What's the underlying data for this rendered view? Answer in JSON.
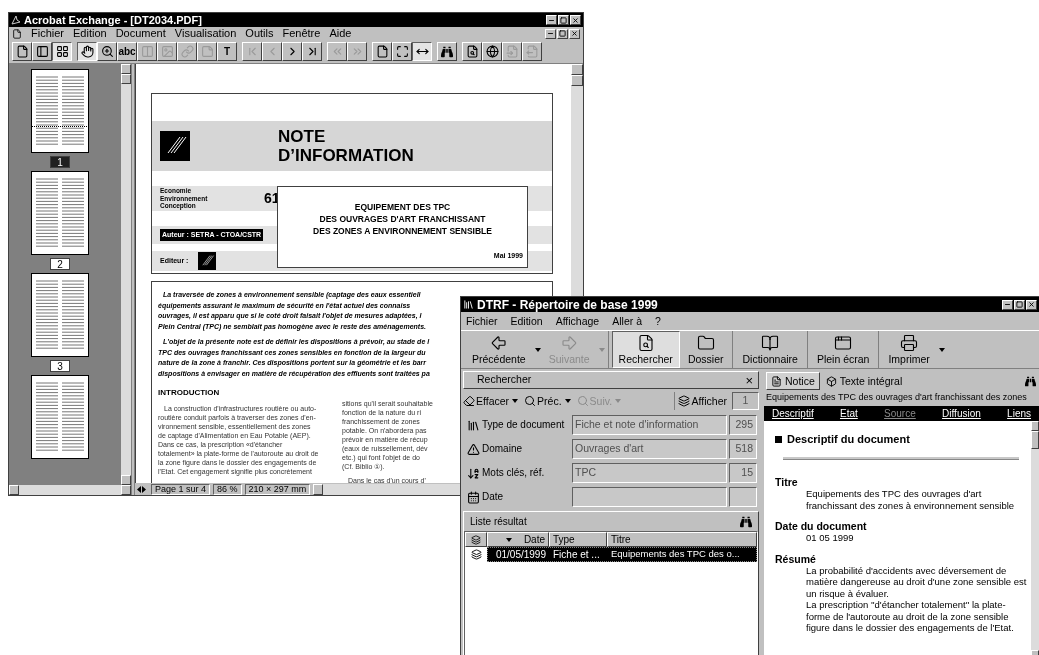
{
  "acrobat": {
    "title": "Acrobat Exchange - [DT2034.PDF]",
    "menu": [
      "Fichier",
      "Edition",
      "Document",
      "Visualisation",
      "Outils",
      "Fenêtre",
      "Aide"
    ],
    "toolbar": [
      [
        {
          "pressed": false,
          "disabled": false
        },
        {
          "pressed": false,
          "disabled": false
        },
        {
          "pressed": true,
          "disabled": false
        }
      ],
      [
        {
          "pressed": true,
          "disabled": false
        },
        {
          "pressed": false,
          "disabled": false
        },
        {
          "pressed": false,
          "disabled": false,
          "label": "abc"
        },
        {
          "pressed": false,
          "disabled": true
        },
        {
          "pressed": false,
          "disabled": true
        },
        {
          "pressed": false,
          "disabled": true
        },
        {
          "pressed": false,
          "disabled": true
        },
        {
          "pressed": false,
          "disabled": false,
          "label": "T"
        }
      ],
      [
        {
          "pressed": false,
          "disabled": true
        },
        {
          "pressed": false,
          "disabled": true
        },
        {
          "pressed": false,
          "disabled": false
        },
        {
          "pressed": false,
          "disabled": false
        }
      ],
      [
        {
          "pressed": false,
          "disabled": true
        },
        {
          "pressed": false,
          "disabled": true
        }
      ],
      [
        {
          "pressed": false,
          "disabled": false
        },
        {
          "pressed": false,
          "disabled": false
        },
        {
          "pressed": true,
          "disabled": false
        }
      ],
      [
        {
          "pressed": false,
          "disabled": false
        }
      ],
      [
        {
          "pressed": false,
          "disabled": false
        },
        {
          "pressed": false,
          "disabled": false
        },
        {
          "pressed": false,
          "disabled": true
        },
        {
          "pressed": false,
          "disabled": true
        }
      ]
    ],
    "thumbnails": [
      {
        "label": "1",
        "selected": true
      },
      {
        "label": "2",
        "selected": false
      },
      {
        "label": "3",
        "selected": false
      },
      {
        "selected": false
      }
    ],
    "document": {
      "title_lines": [
        "NOTE",
        "D’INFORMATION"
      ],
      "categories": [
        "Economie",
        "Environnement",
        "Conception"
      ],
      "number": "61",
      "author": "Auteur : SETRA - CTOA/CSTR",
      "editor": "Editeur :",
      "box_title_lines": [
        "EQUIPEMENT DES TPC",
        "DES OUVRAGES D'ART FRANCHISSANT",
        "DES ZONES A ENVIRONNEMENT SENSIBLE"
      ],
      "box_date": "Mai 1999",
      "abstract": [
        [
          "La traversée de zones à environnement sensible (captage des eaux essentiell",
          "équipements assurant le maximum de sécurité en l'état actuel des connaiss",
          "ouvrages, il est apparu que si le coté droit faisait l'objet de mesures adaptées, l",
          "Plein Central (TPC) ne semblait pas homogène avec le reste des aménagements."
        ],
        [
          "L'objet de la présente note est de définir les dispositions à prévoir, au stade de l",
          "TPC des ouvrages franchissant ces zones sensibles en fonction de la largeur du",
          "nature de la zone à franchir. Ces dispositions portent sur la géométrie et les barr",
          "dispositions à envisager en matière de récupération des effluents sont traitées pa"
        ]
      ],
      "heading": "INTRODUCTION",
      "left_column": [
        "La construction d'infrastructures routière ou auto-",
        "routière conduit parfois à traverser des zones d'en-",
        "vironnement sensible, essentiellement des zones",
        "de captage d'Alimentation en Eau Potable (AEP).",
        "Dans ce cas, la prescription «d'étancher",
        "totalement» la plate-forme de l'autoroute au droit de",
        "la zone figure dans le dossier des engagements de",
        "l'Etat. Cet engagement signifie plus concrètement"
      ],
      "right_column": [
        [
          "sitions qu'il serait souhaitable",
          "fonction de la nature du ri",
          "franchissement de zones",
          "potable. On n'abordera pas",
          "prévoir en matière de récup",
          "(eaux de ruissellement, dév",
          "etc.) qui font l'objet de do",
          "(Cf. Biblio ①)."
        ],
        [
          "Dans le cas d'un cours d'"
        ]
      ]
    },
    "status": {
      "page": "Page 1 sur 4",
      "zoom": "86 %",
      "size": "210 × 297 mm"
    }
  },
  "dtrf": {
    "title": "DTRF - Répertoire de base 1999",
    "menu": [
      "Fichier",
      "Edition",
      "Affichage",
      "Aller à",
      "?"
    ],
    "toolbar": [
      [
        {
          "label": "Précédente",
          "disabled": false,
          "pressed": false,
          "dropdown": true
        },
        {
          "label": "Suivante",
          "disabled": true,
          "pressed": false,
          "dropdown": true
        }
      ],
      [
        {
          "label": "Rechercher",
          "disabled": false,
          "pressed": true,
          "dropdown": false
        },
        {
          "label": "Dossier",
          "disabled": false,
          "pressed": false,
          "dropdown": false
        }
      ],
      [
        {
          "label": "Dictionnaire",
          "disabled": false,
          "pressed": false,
          "dropdown": false
        }
      ],
      [
        {
          "label": "Plein écran",
          "disabled": false,
          "pressed": false,
          "dropdown": false
        }
      ],
      [
        {
          "label": "Imprimer",
          "disabled": false,
          "pressed": false,
          "dropdown": true
        }
      ]
    ],
    "search": {
      "title": "Rechercher",
      "close": "×",
      "actions": [
        {
          "label": "Effacer",
          "disabled": false,
          "dropdown": true
        },
        {
          "label": "Préc.",
          "disabled": false,
          "dropdown": true
        },
        {
          "label": "Suiv.",
          "disabled": true,
          "dropdown": true
        }
      ],
      "show": "Afficher",
      "count": "1",
      "fields": [
        {
          "label": "Type de document",
          "value": "Fiche et note d'information",
          "count": "295"
        },
        {
          "label": "Domaine",
          "value": "Ouvrages d'art",
          "count": "518"
        },
        {
          "label": "Mots clés, réf.",
          "value": "TPC",
          "count": "15"
        },
        {
          "label": "Date"
        }
      ]
    },
    "results": {
      "title": "Liste résultat",
      "columns": [
        "Date",
        "Type",
        "Titre"
      ],
      "rows": [
        {
          "date": "01/05/1999",
          "type": "Fiche et ...",
          "title": "Equipements des TPC des o...",
          "selected": true
        }
      ]
    },
    "notice": {
      "tabs": [
        {
          "label": "Notice",
          "selected": true
        },
        {
          "label": "Texte intégral",
          "selected": false
        }
      ],
      "doc_title": "Equipements des TPC des ouvrages d'art franchissant des zones",
      "links": [
        {
          "label": "Descriptif",
          "disabled": false
        },
        {
          "label": "Etat",
          "disabled": false
        },
        {
          "label": "Source",
          "disabled": true
        },
        {
          "label": "Diffusion",
          "disabled": false
        },
        {
          "label": "Liens",
          "disabled": false
        }
      ],
      "section": "Descriptif du document",
      "entries": [
        {
          "label": "Titre",
          "paragraphs": [
            "Equipements des TPC des ouvrages d'art franchissant des zones à environnement sensible"
          ]
        },
        {
          "label": "Date du document",
          "paragraphs": [
            "01 05 1999"
          ]
        },
        {
          "label": "Résumé",
          "paragraphs": [
            "La probabilité d'accidents avec déversement de matière dangereuse au droit d'une zone sensible est un risque à évaluer.",
            "La prescription ''d'étancher totalement'' la plate-forme de l'autoroute au droit de la zone sensible figure dans le dossier des engagements de l'Etat."
          ]
        }
      ]
    }
  }
}
